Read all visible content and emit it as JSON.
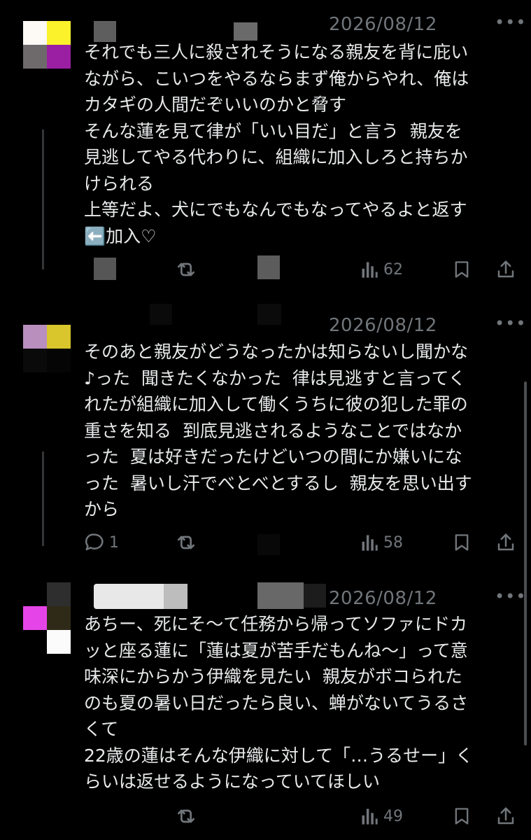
{
  "posts": [
    {
      "date": "2026/08/12",
      "more": "•••",
      "text": "それでも三人に殺されそうになる親友を背に庇い\nながら、こいつをやるならまず俺からやれ、俺は\nカタギの人間だぞいいのかと脅す\nそんな蓮を見て律が「いい目だ」と言う  親友を\n見逃してやる代わりに、組織に加入しろと持ちか\nけられる\n上等だよ、犬にでもなんでもなってやるよと返す\n⬅️加入♡",
      "views": "62"
    },
    {
      "date": "2026/08/12",
      "more": "•••",
      "text": "そのあと親友がどうなったかは知らないし聞かな\n♪った  聞きたくなかった  律は見逃すと言ってく\nれたが組織に加入して働くうちに彼の犯した罪の\n重さを知る  到底見逃されるようなことではなか\nった  夏は好きだったけどいつの間にか嫌いにな\nった  暑いし汗でべとべとするし  親友を思い出す\nから",
      "replies": "1",
      "views": "58"
    },
    {
      "date": "2026/08/12",
      "more": "•••",
      "text": "あちー、死にそ〜て任務から帰ってソファにドカ\nッと座る蓮に「蓮は夏が苦手だもんね〜」って意\n味深にからかう伊織を見たい  親友がボコられた\nのも夏の暑い日だったら良い、蝉がないてうるさ\nくて\n22歳の蓮はそんな伊織に対して「…うるせー」く\nらいは返せるようになっていてほしい",
      "views": "49"
    }
  ],
  "icons": {
    "reply": "reply-icon",
    "repost": "repost-icon",
    "views": "views-icon",
    "bookmark": "bookmark-icon",
    "share": "share-icon"
  },
  "colors": {
    "background": "#000000",
    "text": "#e7e9ea",
    "muted": "#71767b"
  }
}
